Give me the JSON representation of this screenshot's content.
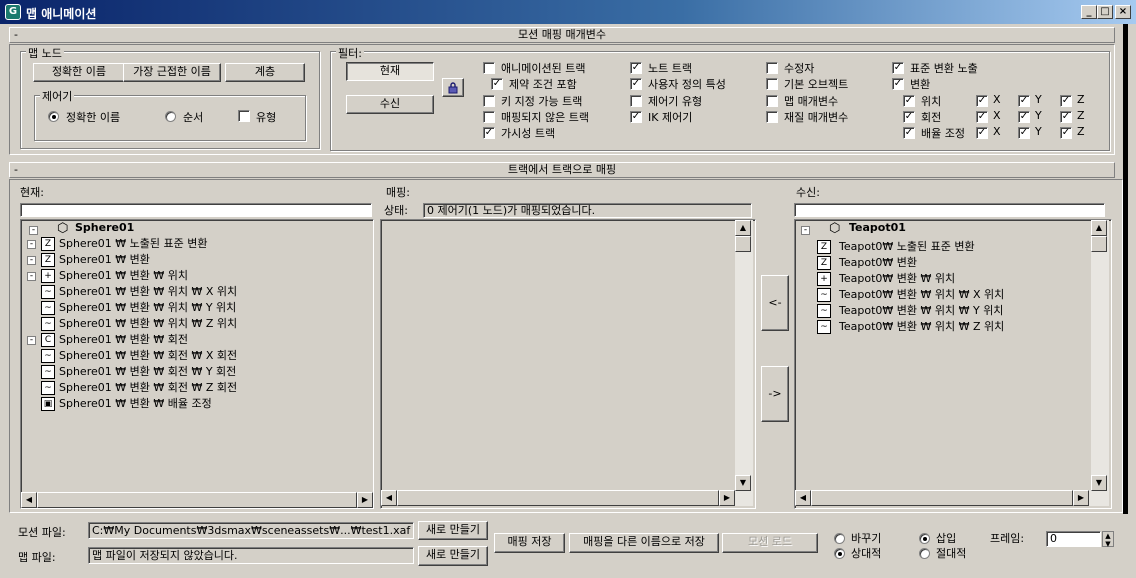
{
  "window": {
    "title": "맵 애니메이션",
    "controls": [
      "_",
      "□",
      "×"
    ]
  },
  "motion_params": {
    "rollout_title": "모션 매핑 매개변수",
    "rollout_toggle": "-",
    "map_node": {
      "label": "맵 노드",
      "buttons": [
        "정확한 이름",
        "가장 근접한 이름",
        "계층"
      ],
      "controller": {
        "label": "제어기",
        "options": [
          {
            "label": "정확한 이름",
            "selected": true
          },
          {
            "label": "순서",
            "selected": false
          }
        ],
        "type_checkbox": {
          "label": "유형",
          "checked": false
        }
      }
    },
    "filter": {
      "label": "필터:",
      "current_button": "현재",
      "target_button": "수신",
      "lock_icon": "lock-icon",
      "col1": [
        {
          "label": "애니메이션된 트랙",
          "checked": false
        },
        {
          "label": "제약 조건 포함",
          "checked": true
        },
        {
          "label": "키 지정 가능 트랙",
          "checked": false
        },
        {
          "label": "매핑되지 않은 트랙",
          "checked": false
        },
        {
          "label": "가시성 트랙",
          "checked": true
        }
      ],
      "col2": [
        {
          "label": "노트 트랙",
          "checked": true
        },
        {
          "label": "사용자 정의 특성",
          "checked": true
        },
        {
          "label": "제어기 유형",
          "checked": false
        },
        {
          "label": "IK 제어기",
          "checked": true
        }
      ],
      "col3": [
        {
          "label": "수정자",
          "checked": false
        },
        {
          "label": "기본 오브젝트",
          "checked": false
        },
        {
          "label": "맵 매개변수",
          "checked": false
        },
        {
          "label": "재질 매개변수",
          "checked": false
        }
      ],
      "col4": {
        "expose": {
          "label": "표준 변환 노출",
          "checked": true
        },
        "transform": {
          "label": "변환",
          "checked": true
        },
        "rows": [
          {
            "label": "위치",
            "checked": true,
            "x": true,
            "y": true,
            "z": true
          },
          {
            "label": "회전",
            "checked": true,
            "x": true,
            "y": true,
            "z": true
          },
          {
            "label": "배율 조정",
            "checked": true,
            "x": true,
            "y": true,
            "z": true
          }
        ],
        "axes": [
          "X",
          "Y",
          "Z"
        ]
      }
    }
  },
  "track_mapping": {
    "rollout_title": "트랙에서 트랙으로 매핑",
    "rollout_toggle": "-",
    "current_label": "현재:",
    "mapping_label": "매핑:",
    "target_label": "수신:",
    "status_label": "상태:",
    "status_text": "0 제어기(1 노드)가 매핑되었습니다.",
    "arrow_left": "<-",
    "arrow_right": "->",
    "current_tree": {
      "root": "Sphere01",
      "items": [
        {
          "label": "Sphere01 ₩ 노출된 표준 변환",
          "icon": "Z",
          "exp": "-",
          "indent": 1
        },
        {
          "label": "Sphere01 ₩ 변환",
          "icon": "Z",
          "exp": "-",
          "indent": 1
        },
        {
          "label": "Sphere01 ₩ 변환 ₩ 위치",
          "icon": "+",
          "exp": "-",
          "indent": 1
        },
        {
          "label": "Sphere01 ₩ 변환 ₩ 위치 ₩ X 위치",
          "icon": "~",
          "exp": "",
          "indent": 1
        },
        {
          "label": "Sphere01 ₩ 변환 ₩ 위치 ₩ Y 위치",
          "icon": "~",
          "exp": "",
          "indent": 1
        },
        {
          "label": "Sphere01 ₩ 변환 ₩ 위치 ₩ Z 위치",
          "icon": "~",
          "exp": "",
          "indent": 1
        },
        {
          "label": "Sphere01 ₩ 변환 ₩ 회전",
          "icon": "C",
          "exp": "-",
          "indent": 1
        },
        {
          "label": "Sphere01 ₩ 변환 ₩ 회전 ₩ X 회전",
          "icon": "~",
          "exp": "",
          "indent": 1
        },
        {
          "label": "Sphere01 ₩ 변환 ₩ 회전 ₩ Y 회전",
          "icon": "~",
          "exp": "",
          "indent": 1
        },
        {
          "label": "Sphere01 ₩ 변환 ₩ 회전 ₩ Z 회전",
          "icon": "~",
          "exp": "",
          "indent": 1
        },
        {
          "label": "Sphere01 ₩ 변환 ₩ 배율 조정",
          "icon": "▣",
          "exp": "",
          "indent": 1
        }
      ]
    },
    "target_tree": {
      "root": "Teapot01",
      "items": [
        {
          "label": "Teapot0₩ 노출된 표준 변환",
          "icon": "Z"
        },
        {
          "label": "Teapot0₩ 변환",
          "icon": "Z"
        },
        {
          "label": "Teapot0₩ 변환 ₩ 위치",
          "icon": "+"
        },
        {
          "label": "Teapot0₩ 변환 ₩ 위치 ₩ X 위치",
          "icon": "~"
        },
        {
          "label": "Teapot0₩ 변환 ₩ 위치 ₩ Y 위치",
          "icon": "~"
        },
        {
          "label": "Teapot0₩ 변환 ₩ 위치 ₩ Z 위치",
          "icon": "~"
        }
      ]
    }
  },
  "bottom": {
    "motion_file_label": "모션 파일:",
    "motion_file_value": "C:₩My Documents₩3dsmax₩sceneassets₩...₩test1.xaf",
    "map_file_label": "맵 파일:",
    "map_file_value": "맵 파일이 저장되지 않았습니다.",
    "new_button": "새로 만들기",
    "new_button2": "새로 만들기",
    "save_map": "매핑 저장",
    "save_map_as": "매핑을 다른 이름으로 저장",
    "load_motion": "모션 로드",
    "replace": {
      "label": "바꾸기",
      "selected": false
    },
    "relative": {
      "label": "상대적",
      "selected": true
    },
    "insert": {
      "label": "삽입",
      "selected": true
    },
    "absolute": {
      "label": "절대적",
      "selected": false
    },
    "frame_label": "프레임:",
    "frame_value": "0"
  }
}
